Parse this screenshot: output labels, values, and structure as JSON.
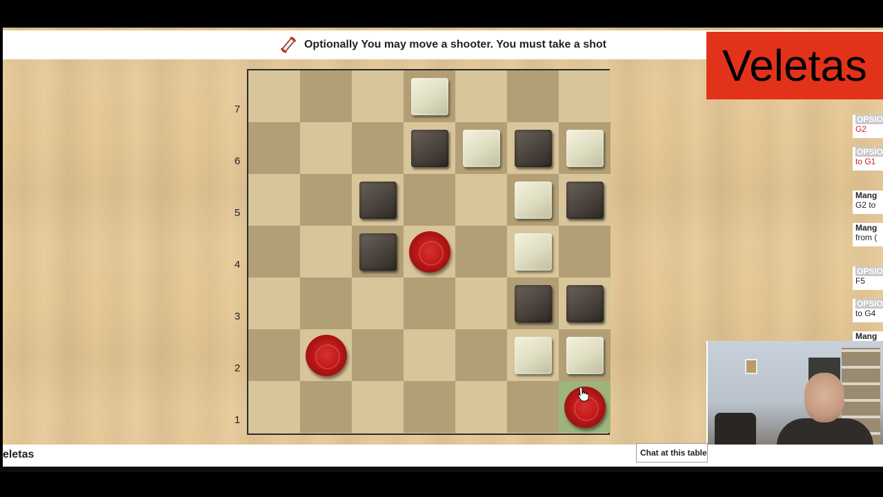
{
  "status_bar": {
    "message": "Optionally You may move a shooter. You must take a shot",
    "icon": "scroll-icon"
  },
  "game_title": "Veletas",
  "bottom_bar": {
    "title": "eletas",
    "chat_button": "Chat at this table"
  },
  "board": {
    "files": 7,
    "ranks": [
      "7",
      "6",
      "5",
      "4",
      "3",
      "2",
      "1"
    ],
    "cells": [
      [
        "",
        "",
        "",
        "W",
        "",
        "",
        ""
      ],
      [
        "",
        "",
        "",
        "B",
        "W",
        "B",
        "W"
      ],
      [
        "",
        "",
        "B",
        "",
        "",
        "W",
        "B"
      ],
      [
        "",
        "",
        "B",
        "R",
        "",
        "W",
        ""
      ],
      [
        "",
        "",
        "",
        "",
        "",
        "B",
        "B"
      ],
      [
        "",
        "R",
        "",
        "",
        "",
        "W",
        "W"
      ],
      [
        "",
        "",
        "",
        "",
        "",
        "",
        "R"
      ]
    ],
    "highlight": {
      "rank": "1",
      "file_index": 6
    },
    "legend": {
      "W": "light shooter",
      "B": "dark veleta",
      "R": "red stone"
    }
  },
  "log": [
    {
      "lines": [
        {
          "text": "OPSIO",
          "style": "lbl"
        },
        {
          "text": "G2",
          "style": "red"
        }
      ]
    },
    {
      "lines": [
        {
          "text": "OPSIO",
          "style": "lbl"
        },
        {
          "text": "to G1",
          "style": "red"
        }
      ]
    },
    {
      "lines": [
        {
          "text": "Mang",
          "style": "blk"
        },
        {
          "text": "G2 to",
          "style": "dark"
        }
      ]
    },
    {
      "lines": [
        {
          "text": "Mang",
          "style": "blk"
        },
        {
          "text": "from (",
          "style": "dark"
        }
      ]
    },
    {
      "lines": [
        {
          "text": "OPSIO",
          "style": "lbl"
        },
        {
          "text": "F5",
          "style": "dark"
        }
      ]
    },
    {
      "lines": [
        {
          "text": "OPSIO",
          "style": "lbl"
        },
        {
          "text": "to G4",
          "style": "dark"
        }
      ]
    },
    {
      "lines": [
        {
          "text": "Mang",
          "style": "blk"
        }
      ]
    }
  ]
}
